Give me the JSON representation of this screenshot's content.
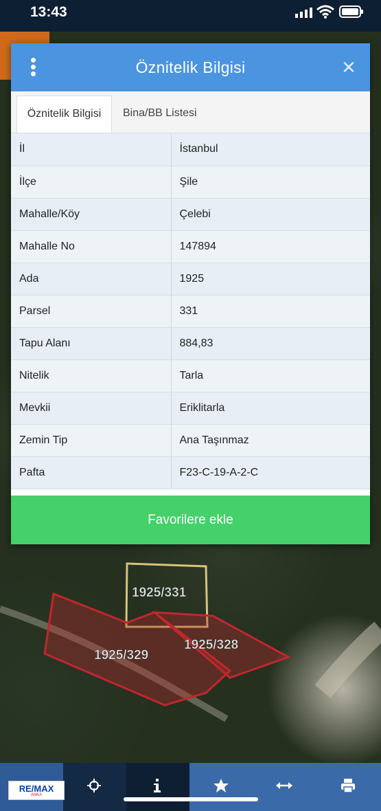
{
  "status_bar": {
    "time": "13:43"
  },
  "dialog": {
    "title": "Öznitelik Bilgisi",
    "tabs": [
      {
        "label": "Öznitelik Bilgisi",
        "active": true
      },
      {
        "label": "Bina/BB Listesi",
        "active": false
      }
    ],
    "rows": [
      {
        "key": "İl",
        "value": "İstanbul"
      },
      {
        "key": "İlçe",
        "value": "Şile"
      },
      {
        "key": "Mahalle/Köy",
        "value": "Çelebi"
      },
      {
        "key": "Mahalle No",
        "value": "147894"
      },
      {
        "key": "Ada",
        "value": "1925"
      },
      {
        "key": "Parsel",
        "value": "331"
      },
      {
        "key": "Tapu Alanı",
        "value": "884,83"
      },
      {
        "key": "Nitelik",
        "value": "Tarla"
      },
      {
        "key": "Mevkii",
        "value": "Eriklitarla"
      },
      {
        "key": "Zemin Tip",
        "value": "Ana Taşınmaz"
      },
      {
        "key": "Pafta",
        "value": "F23-C-19-A-2-C"
      }
    ],
    "favorite_button": "Favorilere ekle"
  },
  "map": {
    "parcels": [
      {
        "label": "1925/331",
        "color": "#d9c27a"
      },
      {
        "label": "1925/329",
        "color": "#c0272d"
      },
      {
        "label": "1925/328",
        "color": "#c0272d"
      }
    ]
  },
  "toolbar": {
    "logo_text": "RE/MAX",
    "logo_sub": "ANKA",
    "icons": [
      "crosshair-icon",
      "info-icon",
      "star-icon",
      "arrows-horizontal-icon",
      "print-icon"
    ]
  },
  "colors": {
    "header": "#4a94e0",
    "favorite": "#45d06a",
    "toolbar": "#3a6aa8"
  }
}
